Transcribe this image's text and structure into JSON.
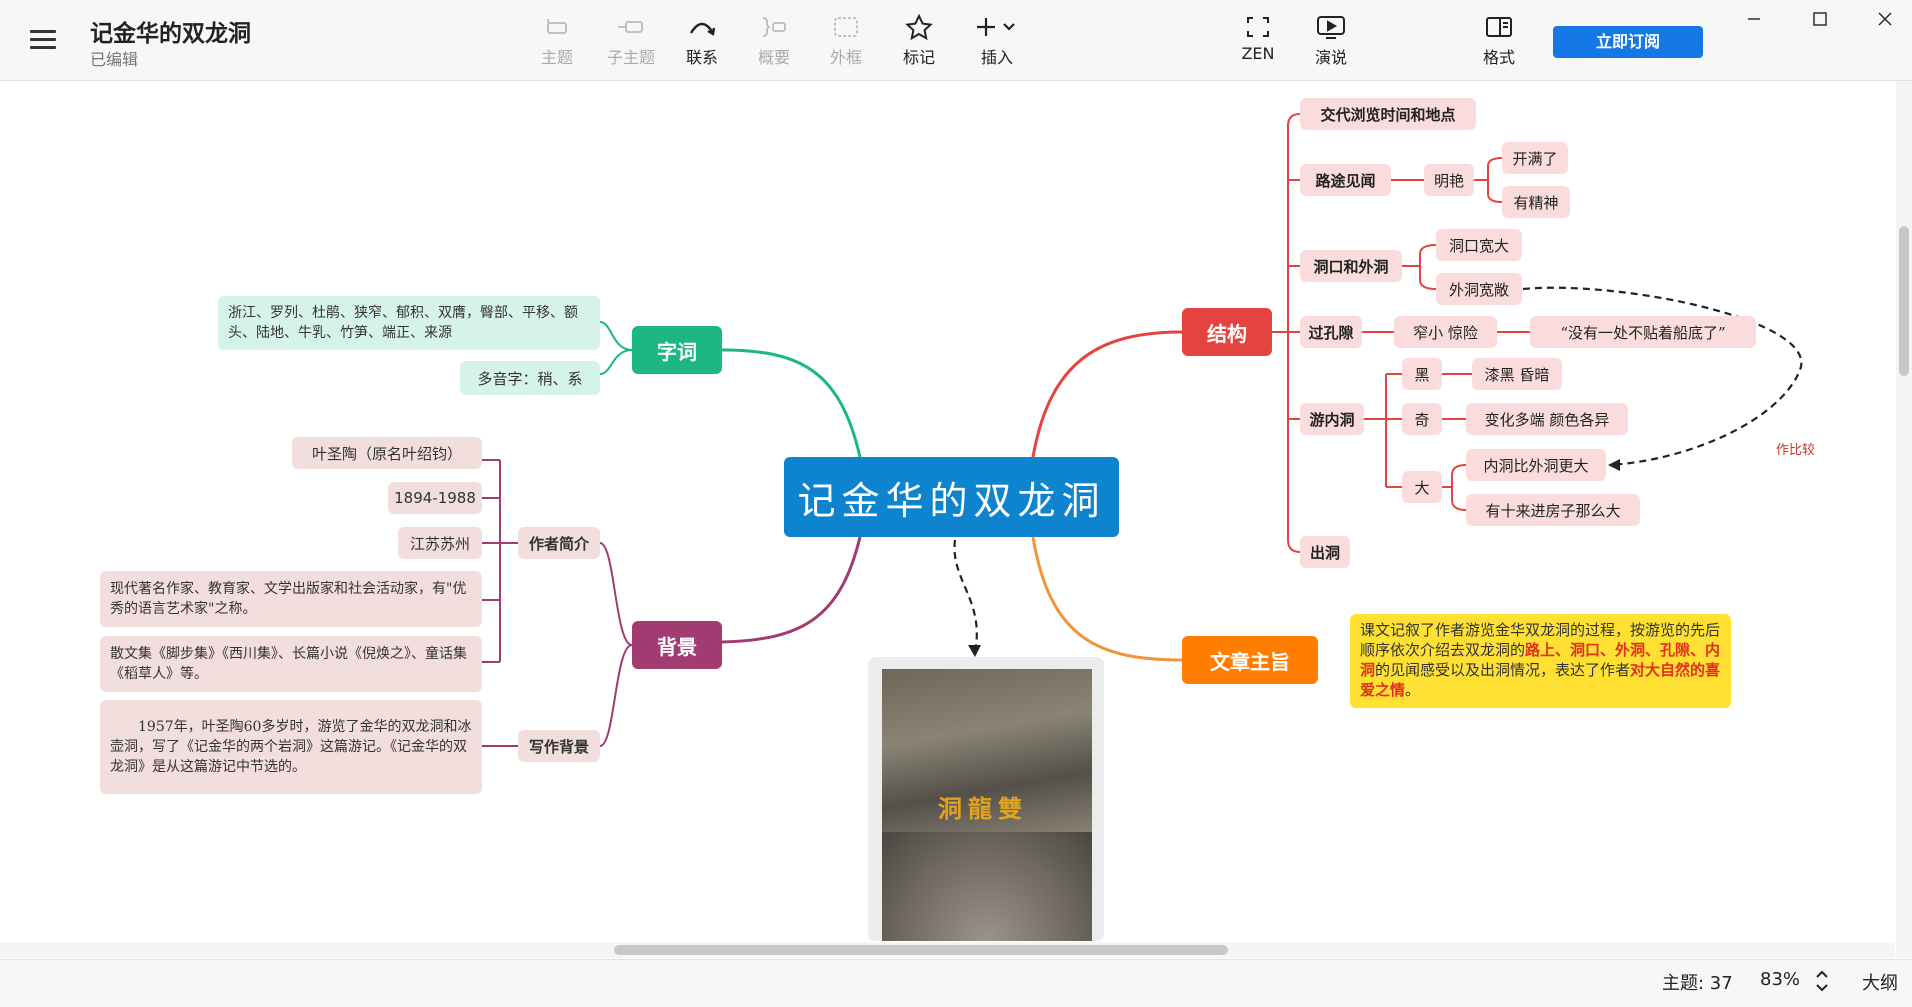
{
  "titlebar": {
    "title": "记金华的双龙洞",
    "subtitle": "已编辑"
  },
  "toolbar": {
    "topic": "主题",
    "subtopic": "子主题",
    "relation": "联系",
    "summary": "概要",
    "boundary": "外框",
    "marker": "标记",
    "insert": "插入",
    "zen": "ZEN",
    "present": "演说",
    "format": "格式",
    "subscribe": "立即订阅"
  },
  "map": {
    "center": "记金华的双龙洞",
    "branches": {
      "ziyi": "字词",
      "beijing": "背景",
      "jiegou": "结构",
      "zhuzhi": "文章主旨"
    },
    "ziyi": {
      "words": "浙江、罗列、杜鹃、狭窄、郁积、双膺，臀部、平移、额头、陆地、牛乳、竹笋、端正、来源",
      "poly": "多音字：稍、系"
    },
    "beijing": {
      "author": "作者简介",
      "writing": "写作背景",
      "author_items": [
        "叶圣陶（原名叶绍钧）",
        "1894-1988",
        "江苏苏州",
        "现代著名作家、教育家、文学出版家和社会活动家，有\"优秀的语言艺术家\"之称。",
        "散文集《脚步集》《西川集》、长篇小说《倪焕之》、童话集《稻草人》等。"
      ],
      "writing_text": "　　1957年，叶圣陶60多岁时，游览了金华的双龙洞和冰壶洞，写了《记金华的两个岩洞》这篇游记。《记金华的双龙洞》是从这篇游记中节选的。"
    },
    "jiegou": {
      "n1": "交代浏览时间和地点",
      "n2": "路途见闻",
      "n2a": "明艳",
      "n2a1": "开满了",
      "n2a2": "有精神",
      "n3": "洞口和外洞",
      "n3a": "洞口宽大",
      "n3b": "外洞宽敞",
      "n4": "过孔隙",
      "n4a": "窄小 惊险",
      "n4b": "“没有一处不贴着船底了”",
      "n5": "游内洞",
      "n5a": "黑",
      "n5a1": "漆黑 昏暗",
      "n5b": "奇",
      "n5b1": "变化多端 颜色各异",
      "n5c": "大",
      "n5c1": "内洞比外洞更大",
      "n5c2": "有十来进房子那么大",
      "n6": "出洞",
      "compare": "作比较"
    },
    "zhuzhi": {
      "p1": "课文记叙了作者游览金华双龙洞的过程，按游览的先后顺序依次介绍去双龙洞的",
      "hl1": "路上、洞口、外洞、孔隙、内洞",
      "p2": "的见闻感受以及出洞情况，表达了作者",
      "hl2": "对大自然的喜爱之情",
      "p3": "。"
    },
    "image_text": "洞龍雙"
  },
  "status": {
    "topics": "主题: 37",
    "zoom": "83%",
    "outline": "大纲"
  }
}
